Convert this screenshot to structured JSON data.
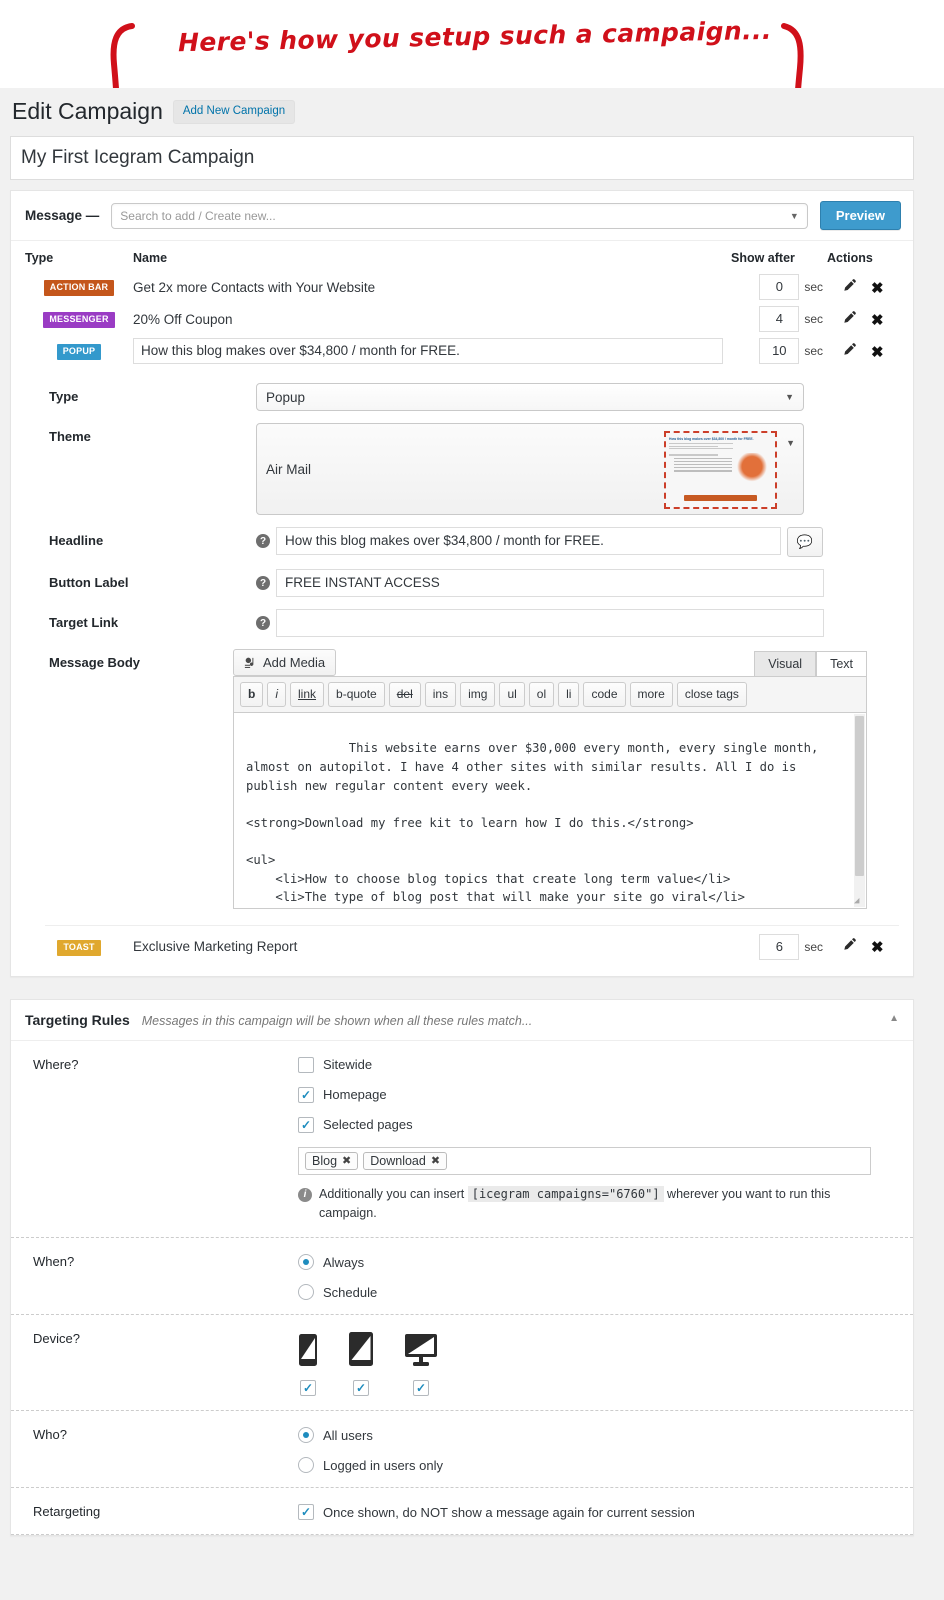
{
  "annotation": {
    "text": "Here's how you setup such a campaign...",
    "color": "#d0101a"
  },
  "header": {
    "title": "Edit Campaign",
    "add_new_button": "Add New Campaign"
  },
  "campaign": {
    "title_value": "My First Icegram Campaign"
  },
  "message_panel": {
    "label": "Message —",
    "search_placeholder": "Search to add / Create new...",
    "preview_button": "Preview",
    "columns": {
      "type": "Type",
      "name": "Name",
      "show_after": "Show after",
      "actions": "Actions"
    },
    "unit": "sec",
    "rows": [
      {
        "type": "ACTION BAR",
        "type_color": "#c4561b",
        "name": "Get 2x more Contacts with Your Website",
        "show_after": "0",
        "editable": false
      },
      {
        "type": "MESSENGER",
        "type_color": "#9a3cc4",
        "name": "20% Off Coupon",
        "show_after": "4",
        "editable": false
      },
      {
        "type": "POPUP",
        "type_color": "#3399cc",
        "name": "How this blog makes over $34,800 / month for FREE.",
        "show_after": "10",
        "editable": true
      }
    ],
    "toast_row": {
      "type": "TOAST",
      "type_color": "#e0a82e",
      "name": "Exclusive Marketing Report",
      "show_after": "6"
    }
  },
  "message_form": {
    "type_label": "Type",
    "type_value": "Popup",
    "theme_label": "Theme",
    "theme_value": "Air Mail",
    "theme_thumb_headline": "How this blog makes over $34,800 / month for FREE.",
    "headline_label": "Headline",
    "headline_value": "How this blog makes over $34,800 / month for FREE.",
    "button_label_label": "Button Label",
    "button_label_value": "FREE INSTANT ACCESS",
    "target_link_label": "Target Link",
    "target_link_value": "",
    "message_body_label": "Message Body",
    "add_media_button": "Add Media",
    "tabs": [
      {
        "label": "Visual",
        "active": false
      },
      {
        "label": "Text",
        "active": true
      }
    ],
    "toolbar_buttons": [
      "b",
      "i",
      "link",
      "b-quote",
      "del",
      "ins",
      "img",
      "ul",
      "ol",
      "li",
      "code",
      "more",
      "close tags"
    ],
    "body_text": "This website earns over $30,000 every month, every single month, almost on autopilot. I have 4 other sites with similar results. All I do is publish new regular content every week.\n\n<strong>Download my free kit to learn how I do this.</strong>\n\n<ul>\n    <li>How to choose blog topics that create long term value</li>\n    <li>The type of blog post that will make your site go viral</li>\n    <li>How to free yourself from the routine tasks</li>\n    <li>Resources and tips to get started quickly</li>"
  },
  "targeting": {
    "title": "Targeting Rules",
    "subtitle": "Messages in this campaign will be shown when all these rules match...",
    "where": {
      "label": "Where?",
      "options": [
        {
          "label": "Sitewide",
          "checked": false
        },
        {
          "label": "Homepage",
          "checked": true
        },
        {
          "label": "Selected pages",
          "checked": true
        }
      ],
      "tags": [
        "Blog",
        "Download"
      ],
      "note_before": "Additionally you can insert",
      "shortcode": "[icegram campaigns=\"6760\"]",
      "note_after": "wherever you want to run this campaign."
    },
    "when": {
      "label": "When?",
      "options": [
        {
          "label": "Always",
          "selected": true
        },
        {
          "label": "Schedule",
          "selected": false
        }
      ]
    },
    "device": {
      "label": "Device?",
      "items": [
        {
          "icon": "mobile-icon",
          "checked": true
        },
        {
          "icon": "tablet-icon",
          "checked": true
        },
        {
          "icon": "desktop-icon",
          "checked": true
        }
      ]
    },
    "who": {
      "label": "Who?",
      "options": [
        {
          "label": "All users",
          "selected": true
        },
        {
          "label": "Logged in users only",
          "selected": false
        }
      ]
    },
    "retargeting": {
      "label": "Retargeting",
      "option": {
        "label": "Once shown, do NOT show a message again for current session",
        "checked": true
      }
    }
  }
}
